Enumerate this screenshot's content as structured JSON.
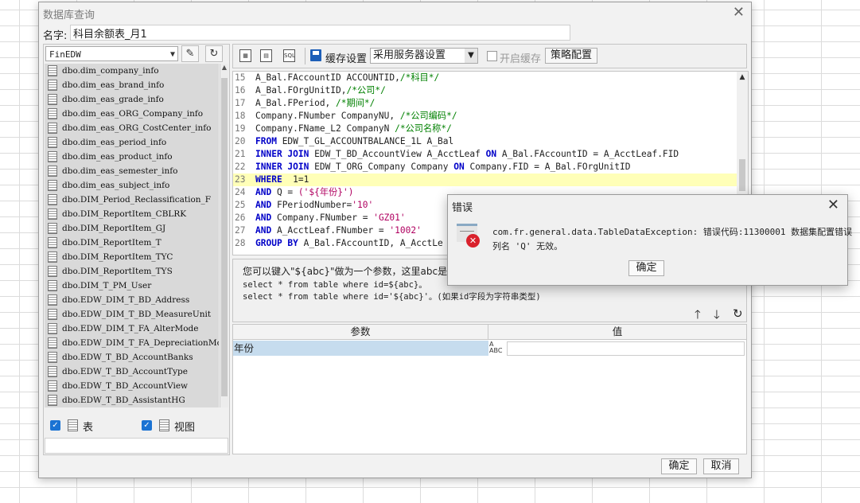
{
  "main_dialog": {
    "title": "数据库查询",
    "close": "✕",
    "name_label": "名字:",
    "name_value": "科目余额表_月1"
  },
  "left_panel": {
    "db_select": "FinEDW",
    "tables": [
      "dbo.dim_company_info",
      "dbo.dim_eas_brand_info",
      "dbo.dim_eas_grade_info",
      "dbo.dim_eas_ORG_Company_info",
      "dbo.dim_eas_ORG_CostCenter_info",
      "dbo.dim_eas_period_info",
      "dbo.dim_eas_product_info",
      "dbo.dim_eas_semester_info",
      "dbo.dim_eas_subject_info",
      "dbo.DIM_Period_Reclassification_F",
      "dbo.DIM_ReportItem_CBLRK",
      "dbo.DIM_ReportItem_GJ",
      "dbo.DIM_ReportItem_T",
      "dbo.DIM_ReportItem_TYC",
      "dbo.DIM_ReportItem_TYS",
      "dbo.DIM_T_PM_User",
      "dbo.EDW_DIM_T_BD_Address",
      "dbo.EDW_DIM_T_BD_MeasureUnit",
      "dbo.EDW_DIM_T_FA_AlterMode",
      "dbo.EDW_DIM_T_FA_DepreciationMode",
      "dbo.EDW_T_BD_AccountBanks",
      "dbo.EDW_T_BD_AccountType",
      "dbo.EDW_T_BD_AccountView",
      "dbo.EDW_T_BD_AssistantHG"
    ],
    "filter_table_label": "表",
    "filter_view_label": "视图"
  },
  "toolbar": {
    "cache_label": "缓存设置",
    "cache_select": "采用服务器设置",
    "enable_cache_label": "开启缓存",
    "strategy_button": "策略配置"
  },
  "editor": {
    "lines": [
      {
        "n": "15",
        "parts": [
          [
            "",
            "A_Bal.FAccountID ACCOUNTID,"
          ],
          [
            "cm",
            "/*科目*/"
          ]
        ]
      },
      {
        "n": "16",
        "parts": [
          [
            "",
            "A_Bal.FOrgUnitID,"
          ],
          [
            "cm",
            "/*公司*/"
          ]
        ]
      },
      {
        "n": "17",
        "parts": [
          [
            "",
            "A_Bal.FPeriod, "
          ],
          [
            "cm",
            "/*期间*/"
          ]
        ]
      },
      {
        "n": "18",
        "parts": [
          [
            "",
            "Company.FNumber CompanyNU, "
          ],
          [
            "cm",
            "/*公司编码*/"
          ]
        ]
      },
      {
        "n": "19",
        "parts": [
          [
            "",
            "Company.FName_L2 CompanyN "
          ],
          [
            "cm",
            "/*公司名称*/"
          ]
        ]
      },
      {
        "n": "20",
        "parts": [
          [
            "kw",
            "FROM"
          ],
          [
            "",
            " EDW_T_GL_ACCOUNTBALANCE_1L A_Bal"
          ]
        ]
      },
      {
        "n": "21",
        "parts": [
          [
            "kw",
            "INNER JOIN"
          ],
          [
            "",
            " EDW_T_BD_AccountView A_AcctLeaf "
          ],
          [
            "kw",
            "ON"
          ],
          [
            "",
            " A_Bal.FAccountID = A_AcctLeaf.FID"
          ]
        ]
      },
      {
        "n": "22",
        "parts": [
          [
            "kw",
            "INNER JOIN"
          ],
          [
            "",
            " EDW_T_ORG_Company Company "
          ],
          [
            "kw",
            "ON"
          ],
          [
            "",
            " Company.FID = A_Bal.FOrgUnitID"
          ]
        ]
      },
      {
        "n": "23",
        "parts": [
          [
            "kw",
            "WHERE"
          ],
          [
            "",
            "  1=1"
          ]
        ],
        "highlight": true
      },
      {
        "n": "24",
        "parts": [
          [
            "kw",
            "AND"
          ],
          [
            "",
            " Q = "
          ],
          [
            "st",
            "('${年份}')"
          ]
        ]
      },
      {
        "n": "25",
        "parts": [
          [
            "kw",
            "AND"
          ],
          [
            "",
            " FPeriodNumber="
          ],
          [
            "st",
            "'10'"
          ]
        ]
      },
      {
        "n": "26",
        "parts": [
          [
            "kw",
            "AND"
          ],
          [
            "",
            " Company.FNumber = "
          ],
          [
            "st",
            "'GZ01'"
          ]
        ]
      },
      {
        "n": "27",
        "parts": [
          [
            "kw",
            "AND"
          ],
          [
            "",
            " A_AcctLeaf.FNumber = "
          ],
          [
            "st",
            "'1002'"
          ]
        ]
      },
      {
        "n": "28",
        "parts": [
          [
            "kw",
            "GROUP BY"
          ],
          [
            "",
            " A_Bal.FAccountID, A_AcctLe"
          ]
        ]
      }
    ]
  },
  "hint": {
    "line1": "您可以键入\"${abc}\"做为一个参数，这里abc是参",
    "line2": "select * from table where id=${abc}。",
    "line3": "select * from table where id='${abc}'。(如果id字段为字符串类型)"
  },
  "params": {
    "col_param": "参数",
    "col_value": "值",
    "row_name": "年份",
    "row_type_glyph": "ABC"
  },
  "footer": {
    "ok": "确定",
    "cancel": "取消"
  },
  "error_dialog": {
    "title": "错误",
    "close": "✕",
    "message_line1": "com.fr.general.data.TableDataException: 错误代码:11300001 数据集配置错误",
    "message_line2": "列名 'Q' 无效。",
    "ok": "确定"
  }
}
